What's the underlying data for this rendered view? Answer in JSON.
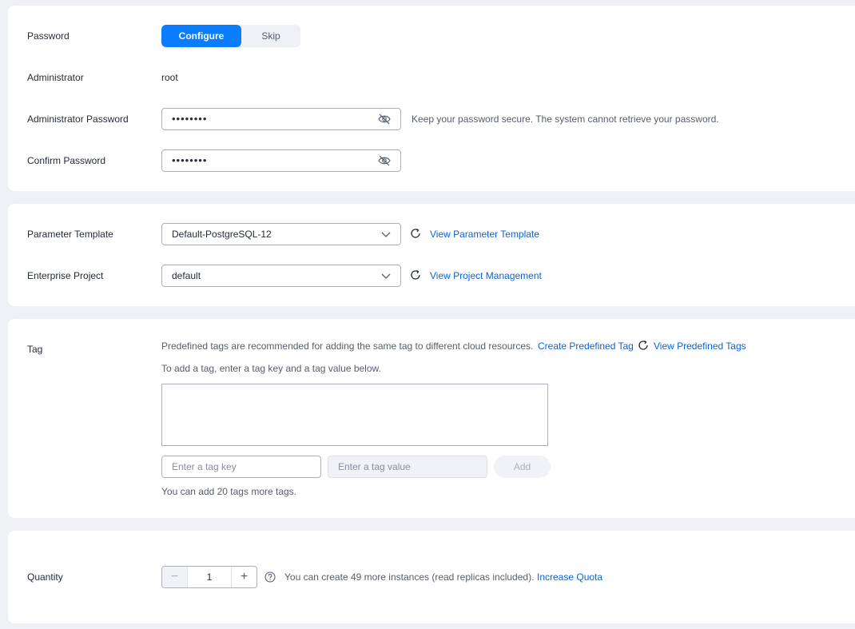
{
  "password": {
    "label": "Password",
    "options": [
      "Configure",
      "Skip"
    ],
    "selected": "Configure"
  },
  "administrator": {
    "label": "Administrator",
    "value": "root"
  },
  "admin_password": {
    "label": "Administrator Password",
    "masked_value": "••••••••",
    "hint": "Keep your password secure. The system cannot retrieve your password."
  },
  "confirm_password": {
    "label": "Confirm Password",
    "masked_value": "••••••••"
  },
  "parameter_template": {
    "label": "Parameter Template",
    "value": "Default-PostgreSQL-12",
    "link": "View Parameter Template"
  },
  "enterprise_project": {
    "label": "Enterprise Project",
    "value": "default",
    "link": "View Project Management"
  },
  "tag": {
    "label": "Tag",
    "info": "Predefined tags are recommended for adding the same tag to different cloud resources.",
    "create_link": "Create Predefined Tag",
    "view_link": "View Predefined Tags",
    "instruction": "To add a tag, enter a tag key and a tag value below.",
    "key_placeholder": "Enter a tag key",
    "value_placeholder": "Enter a tag value",
    "add_label": "Add",
    "remaining": "You can add 20 tags more tags."
  },
  "quantity": {
    "label": "Quantity",
    "value": "1",
    "minus": "−",
    "plus": "+",
    "hint": "You can create 49 more instances (read replicas included).",
    "link": "Increase Quota"
  },
  "colors": {
    "accent": "#0a7cff",
    "link": "#0a63d6",
    "background": "#eff0f4"
  },
  "icons": [
    "eye-off-icon",
    "chevron-down-icon",
    "refresh-icon",
    "help-circle-icon"
  ]
}
